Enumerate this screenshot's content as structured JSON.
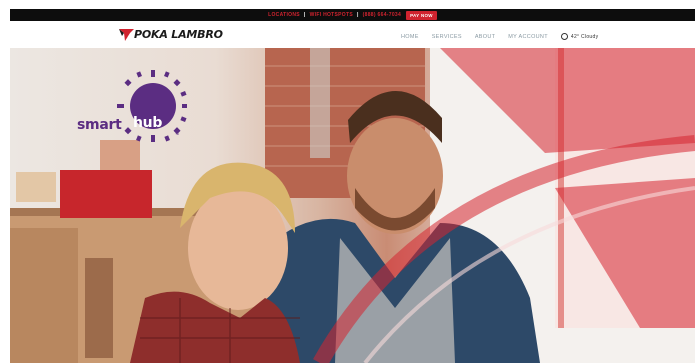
{
  "topbar": {
    "links": [
      "LOCATIONS",
      "WIFI HOTSPOTS",
      "(888) 664-7034"
    ],
    "separator": "|",
    "pay_label": "PAY NOW"
  },
  "header": {
    "logo_text": "POKA LAMBRO",
    "nav": [
      "HOME",
      "SERVICES",
      "ABOUT",
      "MY ACCOUNT"
    ],
    "weather": "42° Cloudy"
  },
  "hero": {
    "logo_smart": "smart",
    "logo_hub": "hub",
    "logo_tm": "™"
  },
  "colors": {
    "brand_red": "#d0232f",
    "hub_purple": "#5b2d82",
    "topbar_bg": "#0d0d0d"
  }
}
